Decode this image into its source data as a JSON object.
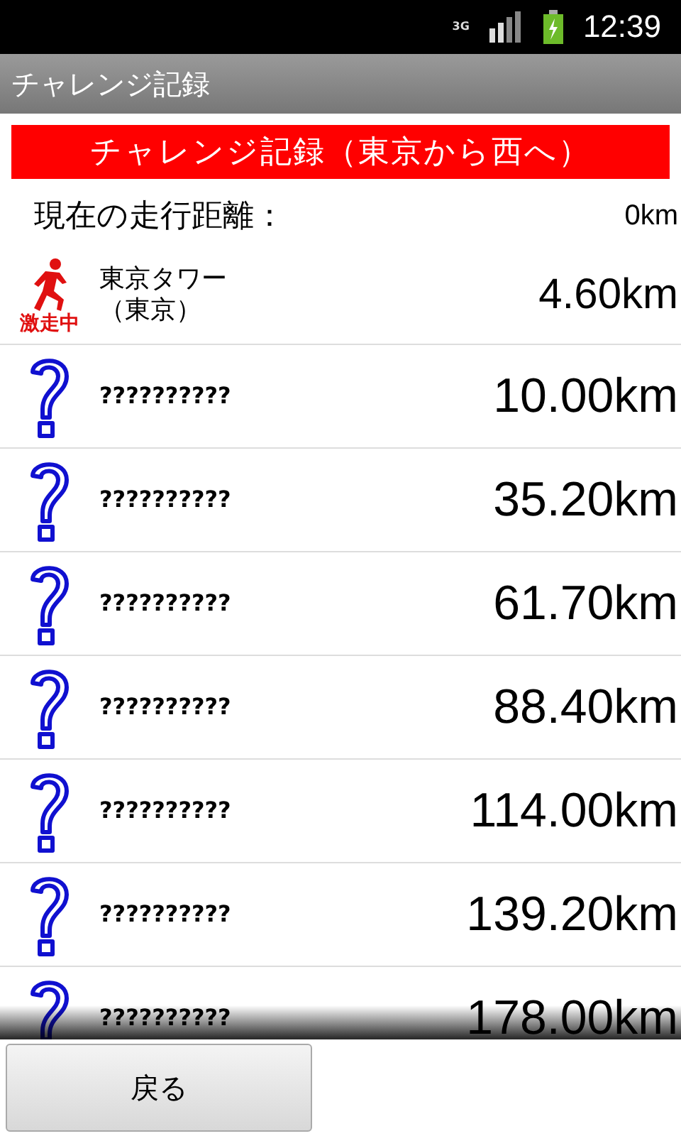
{
  "status_bar": {
    "network": "3G",
    "time": "12:39"
  },
  "title_bar": {
    "title": "チャレンジ記録"
  },
  "banner": {
    "text": "チャレンジ記録（東京から西へ）"
  },
  "current": {
    "label": "現在の走行距離：",
    "value": "0km"
  },
  "checkpoints": [
    {
      "kind": "running",
      "name_lines": [
        "東京タワー",
        "（東京）"
      ],
      "badge": "激走中",
      "distance": "4.60km"
    },
    {
      "kind": "unknown",
      "name_lines": [
        "??????????"
      ],
      "distance": "10.00km"
    },
    {
      "kind": "unknown",
      "name_lines": [
        "??????????"
      ],
      "distance": "35.20km"
    },
    {
      "kind": "unknown",
      "name_lines": [
        "??????????"
      ],
      "distance": "61.70km"
    },
    {
      "kind": "unknown",
      "name_lines": [
        "??????????"
      ],
      "distance": "88.40km"
    },
    {
      "kind": "unknown",
      "name_lines": [
        "??????????"
      ],
      "distance": "114.00km"
    },
    {
      "kind": "unknown",
      "name_lines": [
        "??????????"
      ],
      "distance": "139.20km"
    },
    {
      "kind": "unknown",
      "name_lines": [
        "??????????"
      ],
      "distance": "178.00km"
    }
  ],
  "buttons": [
    {
      "label": "戻る"
    }
  ]
}
